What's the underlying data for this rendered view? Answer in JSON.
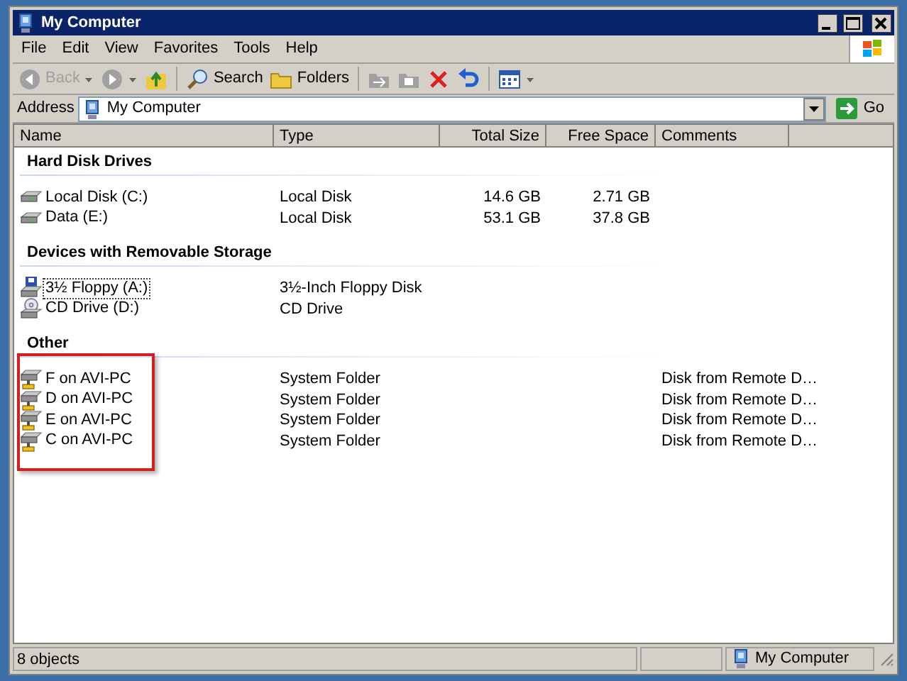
{
  "window": {
    "title": "My Computer"
  },
  "menu": [
    "File",
    "Edit",
    "View",
    "Favorites",
    "Tools",
    "Help"
  ],
  "toolbar": [
    {
      "kind": "back",
      "label": "Back",
      "disabled": true
    },
    {
      "kind": "forward",
      "disabled": true
    },
    {
      "kind": "up",
      "disabled": false
    },
    {
      "kind": "search",
      "label": "Search",
      "disabled": false
    },
    {
      "kind": "folders",
      "label": "Folders",
      "disabled": false
    },
    {
      "kind": "move",
      "disabled": true
    },
    {
      "kind": "copy",
      "disabled": true
    },
    {
      "kind": "delete",
      "disabled": false
    },
    {
      "kind": "undo",
      "disabled": false
    },
    {
      "kind": "views",
      "disabled": false
    }
  ],
  "address": {
    "label": "Address",
    "value": "My Computer",
    "go": "Go"
  },
  "table": {
    "columns": [
      "Name",
      "Type",
      "Total Size",
      "Free Space",
      "Comments"
    ],
    "groups": [
      {
        "heading": "Hard Disk Drives",
        "highlighted": false,
        "items": [
          {
            "kind": "hard-disk",
            "name": "Local Disk (C:)",
            "type": "Local Disk",
            "total_size": "14.6 GB",
            "free_space": "2.71 GB",
            "focused": false
          },
          {
            "kind": "hard-disk",
            "name": "Data (E:)",
            "type": "Local Disk",
            "total_size": "53.1 GB",
            "free_space": "37.8 GB",
            "focused": false
          }
        ]
      },
      {
        "heading": "Devices with Removable Storage",
        "highlighted": false,
        "items": [
          {
            "kind": "floppy",
            "name": "3½ Floppy (A:)",
            "type": "3½-Inch Floppy Disk",
            "focused": true
          },
          {
            "kind": "cd",
            "name": "CD Drive (D:)",
            "type": "CD Drive",
            "focused": false
          }
        ]
      },
      {
        "heading": "Other",
        "highlighted": true,
        "items": [
          {
            "kind": "network-drive",
            "name": "F on AVI-PC",
            "type": "System Folder",
            "comments": "Disk from Remote D…",
            "focused": false
          },
          {
            "kind": "network-drive",
            "name": "D on AVI-PC",
            "type": "System Folder",
            "comments": "Disk from Remote D…",
            "focused": false
          },
          {
            "kind": "network-drive",
            "name": "E on AVI-PC",
            "type": "System Folder",
            "comments": "Disk from Remote D…",
            "focused": false
          },
          {
            "kind": "network-drive",
            "name": "C on AVI-PC",
            "type": "System Folder",
            "comments": "Disk from Remote D…",
            "focused": false
          }
        ]
      }
    ]
  },
  "status_bar": {
    "text": "8 objects",
    "zone": "My Computer"
  }
}
